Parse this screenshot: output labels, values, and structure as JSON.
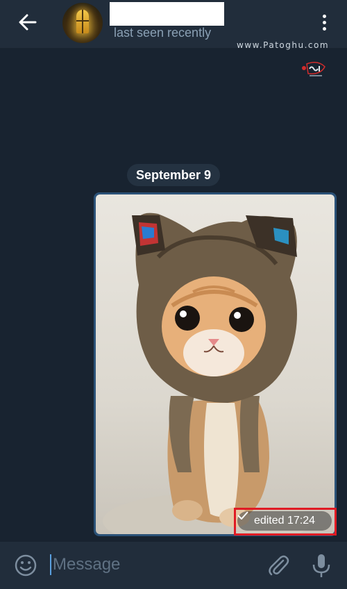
{
  "header": {
    "status": "last seen recently",
    "back_icon": "arrow-left-icon",
    "menu_icon": "more-vertical-icon"
  },
  "watermark": {
    "url": "www.Patoghu.com"
  },
  "chat": {
    "date_label": "September 9",
    "message": {
      "type": "photo",
      "time_label": "edited 17:24",
      "status_icon": "check-icon"
    }
  },
  "input": {
    "placeholder": "Message",
    "emoji_icon": "emoji-icon",
    "attach_icon": "paperclip-icon",
    "mic_icon": "microphone-icon"
  },
  "colors": {
    "background": "#182330",
    "header": "#212d3b",
    "bubble": "#2b5278",
    "highlight": "#e01b24"
  }
}
